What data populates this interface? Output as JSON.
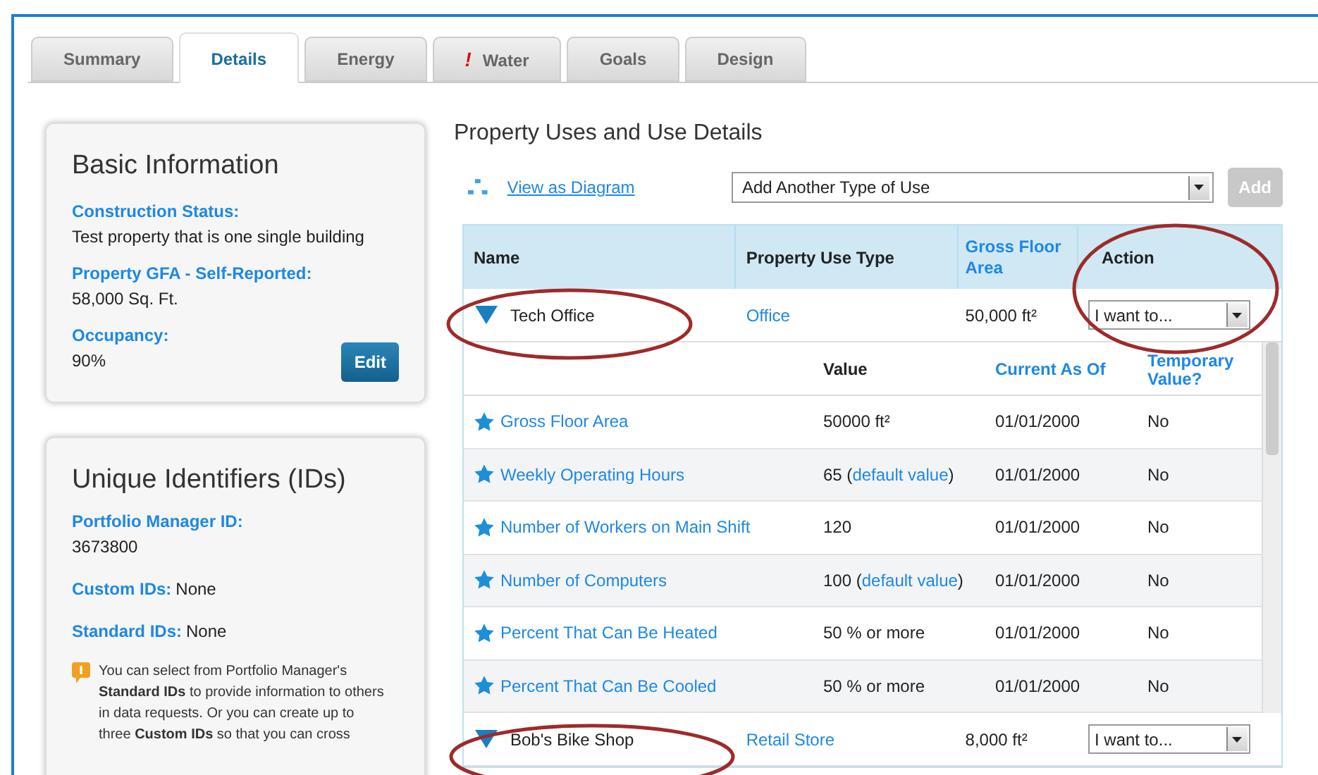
{
  "tabs": [
    {
      "label": "Summary",
      "selected": false,
      "alert": false
    },
    {
      "label": "Details",
      "selected": true,
      "alert": false
    },
    {
      "label": "Energy",
      "selected": false,
      "alert": false
    },
    {
      "label": "Water",
      "selected": false,
      "alert": true,
      "alert_mark": "!"
    },
    {
      "label": "Goals",
      "selected": false,
      "alert": false
    },
    {
      "label": "Design",
      "selected": false,
      "alert": false
    }
  ],
  "basic_info": {
    "title": "Basic Information",
    "fields": [
      {
        "label": "Construction Status:",
        "value": "Test property that is one single building"
      },
      {
        "label": "Property GFA - Self-Reported:",
        "value": "58,000 Sq. Ft."
      },
      {
        "label": "Occupancy:",
        "value": "90%"
      }
    ],
    "edit_button": "Edit"
  },
  "unique_ids": {
    "title": "Unique Identifiers (IDs)",
    "fields": [
      {
        "label": "Portfolio Manager ID:",
        "value": "3673800",
        "inline": false
      },
      {
        "label": "Custom IDs:",
        "value": "None",
        "inline": true
      },
      {
        "label": "Standard IDs:",
        "value": "None",
        "inline": true
      }
    ],
    "info_lines": [
      "You can select from Portfolio Manager's",
      "**Standard IDs** to provide information to others",
      "in data requests. Or you can create up to",
      "three **Custom IDs** so that you can cross"
    ]
  },
  "property_uses": {
    "title": "Property Uses and Use Details",
    "diagram_link": "View as Diagram",
    "add_select": "Add Another Type of Use",
    "add_button": "Add",
    "add_disabled": true,
    "columns": [
      "Name",
      "Property Use Type",
      "Gross Floor Area",
      "Action"
    ],
    "detail_columns": [
      "Value",
      "Current As Of",
      "Temporary Value?"
    ],
    "uses": [
      {
        "name": "Tech Office",
        "type": "Office",
        "gfa": "50,000 ft²",
        "action": "I want to...",
        "expanded": true,
        "details": [
          {
            "name": "Gross Floor Area",
            "value": [
              {
                "text": "50000 ft²",
                "link": false
              }
            ],
            "date": "01/01/2000",
            "temporary": "No"
          },
          {
            "name": "Weekly Operating Hours",
            "value": [
              {
                "text": "65 (",
                "link": false
              },
              {
                "text": "default value",
                "link": true
              },
              {
                "text": ")",
                "link": false
              }
            ],
            "date": "01/01/2000",
            "temporary": "No"
          },
          {
            "name": "Number of Workers on Main Shift",
            "value": [
              {
                "text": "120",
                "link": false
              }
            ],
            "date": "01/01/2000",
            "temporary": "No"
          },
          {
            "name": "Number of Computers",
            "value": [
              {
                "text": "100 (",
                "link": false
              },
              {
                "text": "default value",
                "link": true
              },
              {
                "text": ")",
                "link": false
              }
            ],
            "date": "01/01/2000",
            "temporary": "No"
          },
          {
            "name": "Percent That Can Be Heated",
            "value": [
              {
                "text": "50 % or more",
                "link": false
              }
            ],
            "date": "01/01/2000",
            "temporary": "No"
          },
          {
            "name": "Percent That Can Be Cooled",
            "value": [
              {
                "text": "50 % or more",
                "link": false
              }
            ],
            "date": "01/01/2000",
            "temporary": "No"
          }
        ]
      },
      {
        "name": "Bob's Bike Shop",
        "type": "Retail Store",
        "gfa": "8,000 ft²",
        "action": "I want to...",
        "expanded": true
      }
    ]
  }
}
